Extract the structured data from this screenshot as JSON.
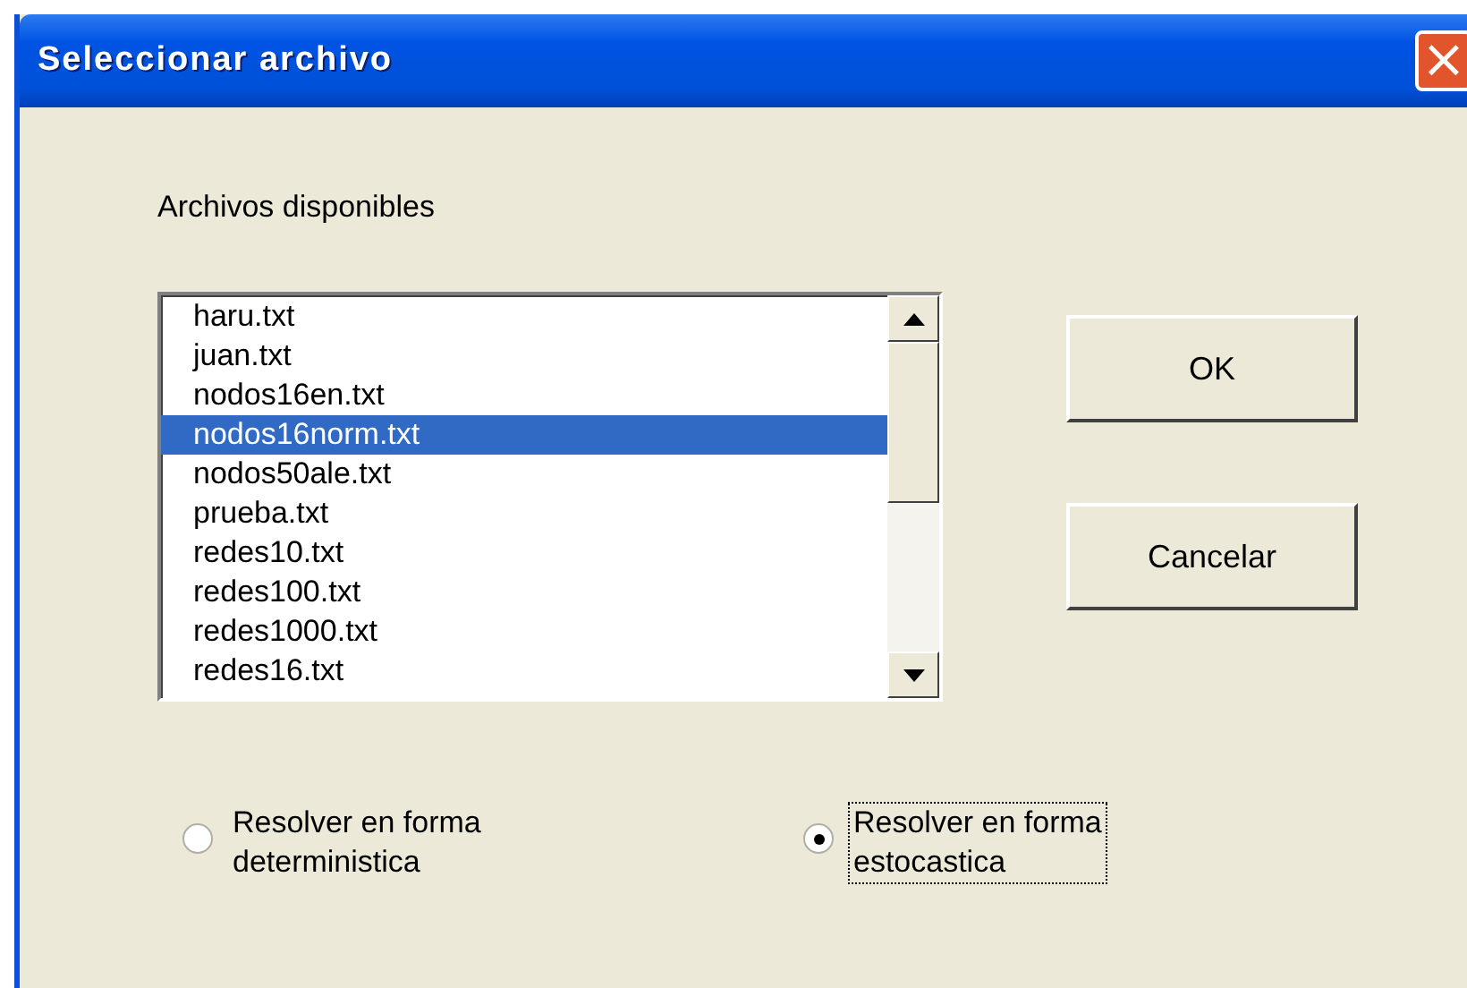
{
  "window": {
    "title": "Seleccionar archivo",
    "close": "×"
  },
  "list_label": "Archivos disponibles",
  "files": [
    {
      "name": "haru.txt",
      "selected": false
    },
    {
      "name": "juan.txt",
      "selected": false
    },
    {
      "name": "nodos16en.txt",
      "selected": false
    },
    {
      "name": "nodos16norm.txt",
      "selected": true
    },
    {
      "name": "nodos50ale.txt",
      "selected": false
    },
    {
      "name": "prueba.txt",
      "selected": false
    },
    {
      "name": "redes10.txt",
      "selected": false
    },
    {
      "name": "redes100.txt",
      "selected": false
    },
    {
      "name": "redes1000.txt",
      "selected": false
    },
    {
      "name": "redes16.txt",
      "selected": false
    }
  ],
  "buttons": [
    "OK",
    "Cancelar"
  ],
  "options": [
    {
      "label": "Resolver en forma\ndeterministica",
      "selected": false
    },
    {
      "label": "Resolver en forma\nestocastica",
      "selected": true
    }
  ]
}
